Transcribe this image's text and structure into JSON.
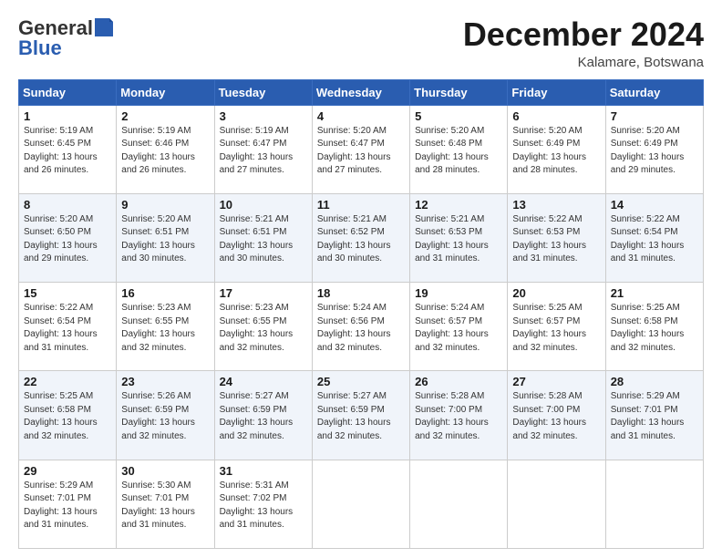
{
  "header": {
    "logo_line1": "General",
    "logo_line2": "Blue",
    "main_title": "December 2024",
    "subtitle": "Kalamare, Botswana"
  },
  "days_of_week": [
    "Sunday",
    "Monday",
    "Tuesday",
    "Wednesday",
    "Thursday",
    "Friday",
    "Saturday"
  ],
  "weeks": [
    [
      {
        "day": "1",
        "sunrise": "5:19 AM",
        "sunset": "6:45 PM",
        "daylight": "13 hours and 26 minutes."
      },
      {
        "day": "2",
        "sunrise": "5:19 AM",
        "sunset": "6:46 PM",
        "daylight": "13 hours and 26 minutes."
      },
      {
        "day": "3",
        "sunrise": "5:19 AM",
        "sunset": "6:47 PM",
        "daylight": "13 hours and 27 minutes."
      },
      {
        "day": "4",
        "sunrise": "5:20 AM",
        "sunset": "6:47 PM",
        "daylight": "13 hours and 27 minutes."
      },
      {
        "day": "5",
        "sunrise": "5:20 AM",
        "sunset": "6:48 PM",
        "daylight": "13 hours and 28 minutes."
      },
      {
        "day": "6",
        "sunrise": "5:20 AM",
        "sunset": "6:49 PM",
        "daylight": "13 hours and 28 minutes."
      },
      {
        "day": "7",
        "sunrise": "5:20 AM",
        "sunset": "6:49 PM",
        "daylight": "13 hours and 29 minutes."
      }
    ],
    [
      {
        "day": "8",
        "sunrise": "5:20 AM",
        "sunset": "6:50 PM",
        "daylight": "13 hours and 29 minutes."
      },
      {
        "day": "9",
        "sunrise": "5:20 AM",
        "sunset": "6:51 PM",
        "daylight": "13 hours and 30 minutes."
      },
      {
        "day": "10",
        "sunrise": "5:21 AM",
        "sunset": "6:51 PM",
        "daylight": "13 hours and 30 minutes."
      },
      {
        "day": "11",
        "sunrise": "5:21 AM",
        "sunset": "6:52 PM",
        "daylight": "13 hours and 30 minutes."
      },
      {
        "day": "12",
        "sunrise": "5:21 AM",
        "sunset": "6:53 PM",
        "daylight": "13 hours and 31 minutes."
      },
      {
        "day": "13",
        "sunrise": "5:22 AM",
        "sunset": "6:53 PM",
        "daylight": "13 hours and 31 minutes."
      },
      {
        "day": "14",
        "sunrise": "5:22 AM",
        "sunset": "6:54 PM",
        "daylight": "13 hours and 31 minutes."
      }
    ],
    [
      {
        "day": "15",
        "sunrise": "5:22 AM",
        "sunset": "6:54 PM",
        "daylight": "13 hours and 31 minutes."
      },
      {
        "day": "16",
        "sunrise": "5:23 AM",
        "sunset": "6:55 PM",
        "daylight": "13 hours and 32 minutes."
      },
      {
        "day": "17",
        "sunrise": "5:23 AM",
        "sunset": "6:55 PM",
        "daylight": "13 hours and 32 minutes."
      },
      {
        "day": "18",
        "sunrise": "5:24 AM",
        "sunset": "6:56 PM",
        "daylight": "13 hours and 32 minutes."
      },
      {
        "day": "19",
        "sunrise": "5:24 AM",
        "sunset": "6:57 PM",
        "daylight": "13 hours and 32 minutes."
      },
      {
        "day": "20",
        "sunrise": "5:25 AM",
        "sunset": "6:57 PM",
        "daylight": "13 hours and 32 minutes."
      },
      {
        "day": "21",
        "sunrise": "5:25 AM",
        "sunset": "6:58 PM",
        "daylight": "13 hours and 32 minutes."
      }
    ],
    [
      {
        "day": "22",
        "sunrise": "5:25 AM",
        "sunset": "6:58 PM",
        "daylight": "13 hours and 32 minutes."
      },
      {
        "day": "23",
        "sunrise": "5:26 AM",
        "sunset": "6:59 PM",
        "daylight": "13 hours and 32 minutes."
      },
      {
        "day": "24",
        "sunrise": "5:27 AM",
        "sunset": "6:59 PM",
        "daylight": "13 hours and 32 minutes."
      },
      {
        "day": "25",
        "sunrise": "5:27 AM",
        "sunset": "6:59 PM",
        "daylight": "13 hours and 32 minutes."
      },
      {
        "day": "26",
        "sunrise": "5:28 AM",
        "sunset": "7:00 PM",
        "daylight": "13 hours and 32 minutes."
      },
      {
        "day": "27",
        "sunrise": "5:28 AM",
        "sunset": "7:00 PM",
        "daylight": "13 hours and 32 minutes."
      },
      {
        "day": "28",
        "sunrise": "5:29 AM",
        "sunset": "7:01 PM",
        "daylight": "13 hours and 31 minutes."
      }
    ],
    [
      {
        "day": "29",
        "sunrise": "5:29 AM",
        "sunset": "7:01 PM",
        "daylight": "13 hours and 31 minutes."
      },
      {
        "day": "30",
        "sunrise": "5:30 AM",
        "sunset": "7:01 PM",
        "daylight": "13 hours and 31 minutes."
      },
      {
        "day": "31",
        "sunrise": "5:31 AM",
        "sunset": "7:02 PM",
        "daylight": "13 hours and 31 minutes."
      },
      null,
      null,
      null,
      null
    ]
  ],
  "labels": {
    "sunrise": "Sunrise:",
    "sunset": "Sunset:",
    "daylight": "Daylight:"
  }
}
